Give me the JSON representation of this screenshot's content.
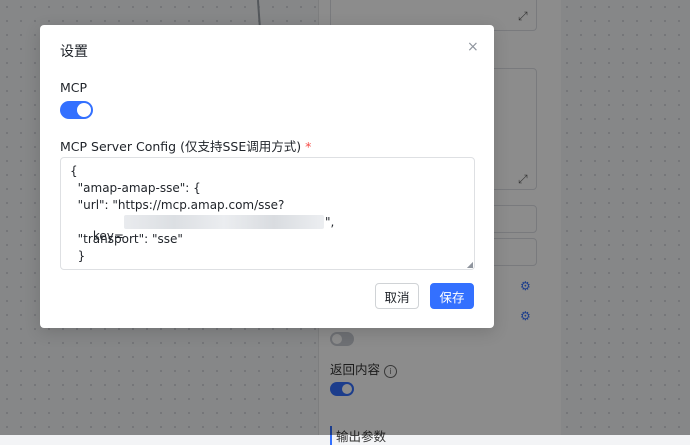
{
  "modal": {
    "title": "设置",
    "close_glyph": "×",
    "mcp_label": "MCP",
    "mcp_enabled": true,
    "config_label": "MCP Server Config (仅支持SSE调用方式)",
    "required_mark": "*",
    "config_lines": [
      "{",
      "  \"amap-amap-sse\": {",
      "  \"url\": \"https://mcp.amap.com/sse?",
      "key=",
      "  \"transport\": \"sse\"",
      "  }"
    ],
    "key_line_suffix": "\",",
    "cancel_label": "取消",
    "save_label": "保存"
  },
  "side_panel": {
    "return_content_label": "返回内容",
    "info_glyph": "i",
    "output_params_label": "输出参数",
    "toggle_a_enabled": false,
    "toggle_b_enabled": true
  },
  "colors": {
    "accent": "#3370ff",
    "required": "#f54a45",
    "overlay": "rgba(0,0,0,0.45)"
  },
  "icons": {
    "close": "close-icon",
    "expand": "expand-icon",
    "gear": "gear-icon",
    "info": "info-icon",
    "resize": "resize-handle-icon"
  }
}
